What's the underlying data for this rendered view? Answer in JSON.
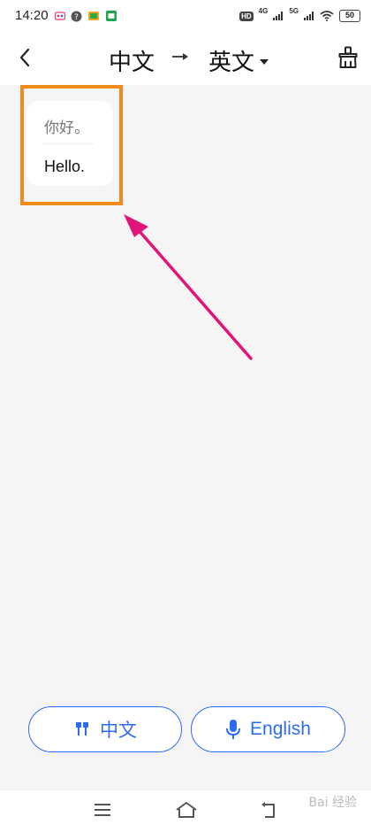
{
  "status_bar": {
    "time": "14:20",
    "network_1": "4G",
    "network_2": "5G",
    "battery": "50"
  },
  "header": {
    "source_language": "中文",
    "target_language": "英文"
  },
  "conversation": {
    "messages": [
      {
        "source_text": "你好。",
        "translated_text": "Hello."
      }
    ]
  },
  "bottom_buttons": {
    "left_label": "中文",
    "right_label": "English"
  },
  "watermark": "Bai 经验",
  "colors": {
    "accent": "#2d6cf0",
    "highlight": "#f28a1d",
    "arrow": "#e0157a",
    "background": "#f5f5f5"
  },
  "icons": [
    "back-icon",
    "arrow-right-icon",
    "dropdown-caret-icon",
    "clear-history-icon",
    "earphones-icon",
    "microphone-icon",
    "menu-icon",
    "home-icon",
    "back-nav-icon"
  ]
}
